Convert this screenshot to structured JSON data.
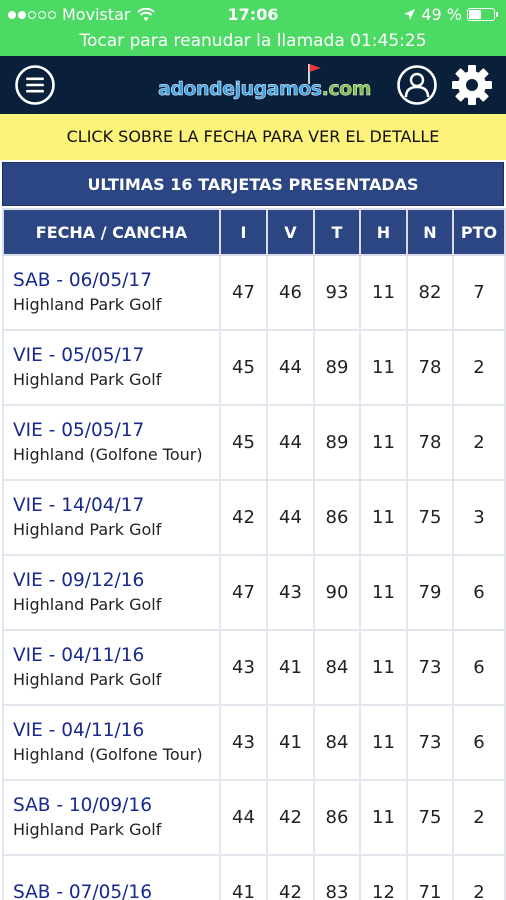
{
  "status_bar": {
    "carrier": "Movistar",
    "time": "17:06",
    "battery_percent": "49 %",
    "battery_level": 0.49
  },
  "call_banner": "Tocar para reanudar la llamada 01:45:25",
  "header": {
    "logo_text_main": "adondejugamos",
    "logo_text_tld": ".com"
  },
  "notice": "CLICK SOBRE LA FECHA PARA VER EL DETALLE",
  "section_title": "ULTIMAS 16 TARJETAS PRESENTADAS",
  "table": {
    "columns": [
      "FECHA / CANCHA",
      "I",
      "V",
      "T",
      "H",
      "N",
      "PTO"
    ],
    "rows": [
      {
        "date": "SAB - 06/05/17",
        "course": "Highland Park Golf",
        "i": "47",
        "v": "46",
        "t": "93",
        "h": "11",
        "n": "82",
        "pto": "7"
      },
      {
        "date": "VIE - 05/05/17",
        "course": "Highland Park Golf",
        "i": "45",
        "v": "44",
        "t": "89",
        "h": "11",
        "n": "78",
        "pto": "2"
      },
      {
        "date": "VIE - 05/05/17",
        "course": "Highland (Golfone Tour)",
        "i": "45",
        "v": "44",
        "t": "89",
        "h": "11",
        "n": "78",
        "pto": "2"
      },
      {
        "date": "VIE - 14/04/17",
        "course": "Highland Park Golf",
        "i": "42",
        "v": "44",
        "t": "86",
        "h": "11",
        "n": "75",
        "pto": "3"
      },
      {
        "date": "VIE - 09/12/16",
        "course": "Highland Park Golf",
        "i": "47",
        "v": "43",
        "t": "90",
        "h": "11",
        "n": "79",
        "pto": "6"
      },
      {
        "date": "VIE - 04/11/16",
        "course": "Highland Park Golf",
        "i": "43",
        "v": "41",
        "t": "84",
        "h": "11",
        "n": "73",
        "pto": "6"
      },
      {
        "date": "VIE - 04/11/16",
        "course": "Highland (Golfone Tour)",
        "i": "43",
        "v": "41",
        "t": "84",
        "h": "11",
        "n": "73",
        "pto": "6"
      },
      {
        "date": "SAB - 10/09/16",
        "course": "Highland Park Golf",
        "i": "44",
        "v": "42",
        "t": "86",
        "h": "11",
        "n": "75",
        "pto": "2"
      },
      {
        "date": "SAB - 07/05/16",
        "course": "",
        "i": "41",
        "v": "42",
        "t": "83",
        "h": "12",
        "n": "71",
        "pto": "2"
      }
    ]
  },
  "colors": {
    "status_green": "#4cd964",
    "header_navy": "#0a1f3a",
    "table_header_blue": "#2c4684",
    "notice_yellow": "#fdf27a",
    "date_link_blue": "#1a2a8c"
  },
  "icons": [
    "signal-dots-icon",
    "wifi-icon",
    "location-arrow-icon",
    "battery-icon",
    "menu-icon",
    "golf-flag-icon",
    "user-icon",
    "gear-icon"
  ]
}
